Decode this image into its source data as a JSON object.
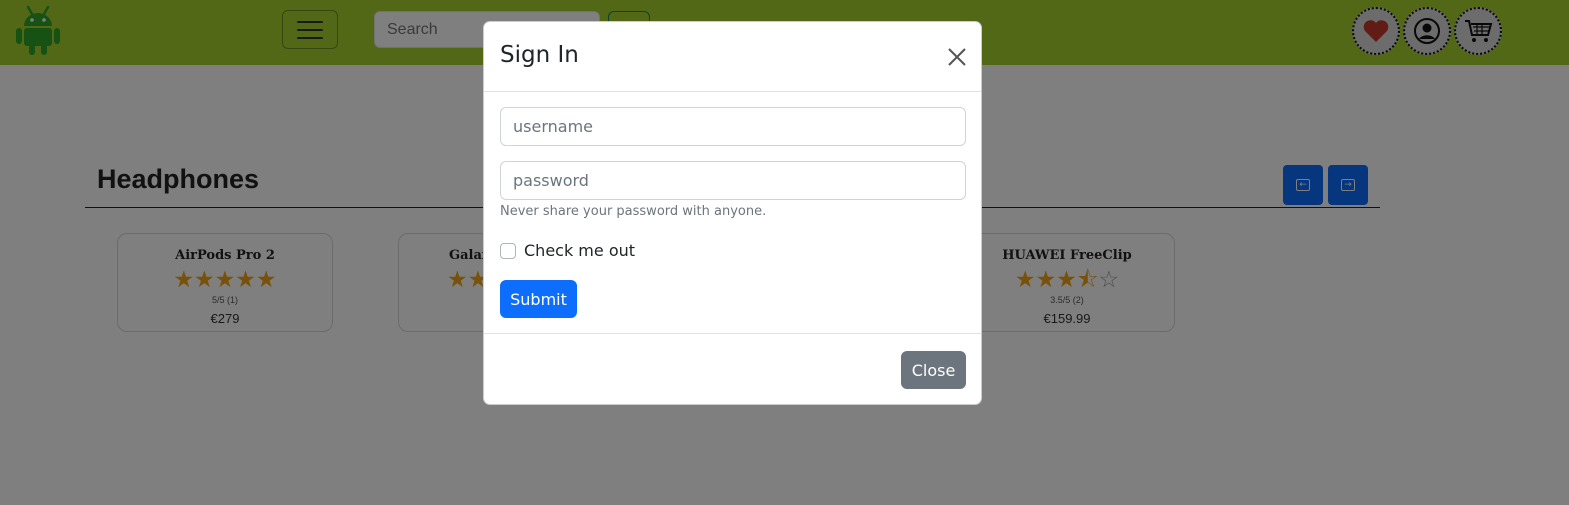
{
  "header": {
    "logo": "android-logo",
    "search_placeholder": "Search",
    "icons": [
      "heart-icon",
      "user-icon",
      "cart-icon"
    ],
    "brand_color": "#a4d12c"
  },
  "section": {
    "title": "Headphones"
  },
  "products": [
    {
      "name": "AirPods Pro 2",
      "stars": "★★★★★",
      "rating": "5/5 (1)",
      "price": "€279"
    },
    {
      "name": "Galax",
      "stars": "★★",
      "rating": "",
      "price": ""
    },
    {
      "name": "HUAWEI FreeClip",
      "stars": "★★★⯪",
      "stars_empty": "☆",
      "rating": "3.5/5 (2)",
      "price": "€159.99"
    }
  ],
  "modal": {
    "title": "Sign In",
    "username_placeholder": "username",
    "password_placeholder": "password",
    "help_text": "Never share your password with anyone.",
    "checkbox_label": "Check me out",
    "submit_label": "Submit",
    "close_label": "Close"
  },
  "colors": {
    "primary": "#0d6efd",
    "secondary": "#6c757d",
    "star": "#f1a316"
  }
}
